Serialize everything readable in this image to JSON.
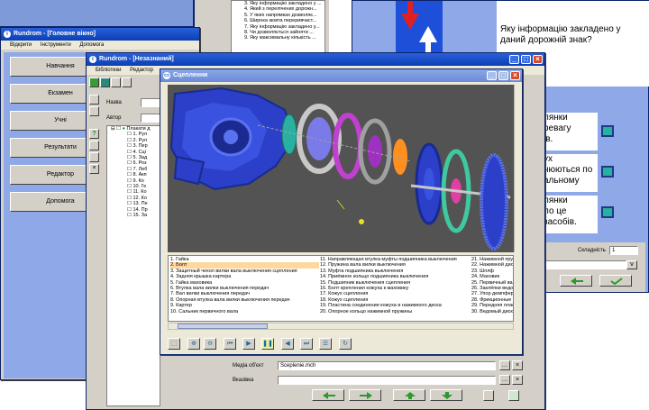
{
  "question_window": {
    "question_text": "Яку інформацію закладено у даний дорожній знак?",
    "answers": [
      "лянки\nревагу\nів.",
      "ух\nнюються по\nальному",
      "лянки\nло це\nзасобів."
    ],
    "complexity_label": "Складність",
    "complexity_value": "1"
  },
  "topics_list": {
    "items": [
      "3. Яку інформацію закладено у ...",
      "4. Який з перелічених дорожн...",
      "5. У яких напрямках дозволяє...",
      "6. Широка жовта переривчаст...",
      "7. Яку інформацію закладено у...",
      "8. Чи дозволяється зайняти ...",
      "9. Яку максимальну кількість ..."
    ]
  },
  "main_window": {
    "title": "Rundrom - [Головне вікно]",
    "menu": [
      "Відкрити",
      "Інструменти",
      "Допомога"
    ],
    "buttons": [
      "Навчання",
      "Екзамен",
      "Учні",
      "Результати",
      "Редактор",
      "Допомога"
    ]
  },
  "editor_window": {
    "title": "Rundrom - [Незазнаний]",
    "menu": [
      "Бібліотеки",
      "Редактор"
    ],
    "name_label": "Назва",
    "author_label": "Автор",
    "tree_root": "Плакати д",
    "tree_items": [
      "1. Рул",
      "2. Рул",
      "3. Пер",
      "4. Сці",
      "5. Зад",
      "6. Роз",
      "7. Леб",
      "8. Акп",
      "9. Ко",
      "10. Ге",
      "11. Ко",
      "12. Ко",
      "13. Пе",
      "14. Пр",
      "15. За"
    ],
    "media_label": "Медіа об'єкт",
    "media_value": "Sceplenie.mch",
    "hint_label": "Вказівка"
  },
  "viewer_window": {
    "title": "Сцеплення",
    "legend": [
      [
        "1. Гайка",
        "11. Направляющая втулка муфты подшипника выключения",
        "21. Нажимной пруж"
      ],
      [
        "2. Болт",
        "12. Пружина вала вилки выключения",
        "22. Нажимной диск"
      ],
      [
        "3. Защитный чехол вилки вала выключения сцепления",
        "13. Муфта подшипника выключения",
        "23. Шплф"
      ],
      [
        "4. Задняя крышка картера",
        "14. Приёмное кольцо подшипника выключения",
        "24. Маховик"
      ],
      [
        "5. Гайка маховика",
        "15. Подшипник выключения сцепления",
        "25. Первичный вал"
      ],
      [
        "6. Втулка вала вилки выключения передач",
        "16. Болт крепления кожуха к маховику",
        "26. Заклёпки ведо"
      ],
      [
        "7. Вал вилки выключения передач",
        "17. Кожух сцепления",
        "27. Упор демпфера"
      ],
      [
        "8. Опорная втулка вала вилки выключения передач",
        "18. Кожух сцепления",
        "28. Фрикционные н"
      ],
      [
        "9. Картер",
        "19. Пластина соединения кожуха и нажимного диска",
        "29. Передняя пласт"
      ],
      [
        "10. Сальник первичного вала",
        "20. Опорное кольцо нажимной пружины",
        "30. Ведомый диск"
      ]
    ]
  },
  "colors": {
    "titlebar": "#0a3fb5",
    "viewport_bg": "#535353",
    "part_blue": "#2b3fc8",
    "sign_blue": "#1e4fd8",
    "sign_red": "#e02020"
  }
}
